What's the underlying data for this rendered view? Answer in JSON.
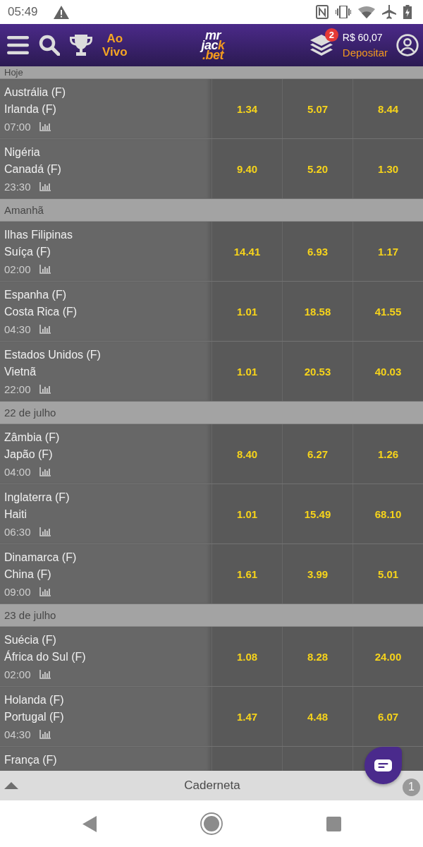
{
  "status_bar": {
    "time": "05:49"
  },
  "header": {
    "live_label": "Ao Vivo",
    "logo": {
      "lines": [
        [
          {
            "text": "mr",
            "accent": false
          }
        ],
        [
          {
            "text": "jac",
            "accent": false
          },
          {
            "text": "k",
            "accent": true
          }
        ],
        [
          {
            "text": ".bet",
            "accent": true
          }
        ]
      ]
    },
    "bets_badge": "2",
    "balance": "R$ 60,07",
    "deposit_label": "Depositar"
  },
  "sections": [
    {
      "label": "Hoje",
      "matches": [
        {
          "teams": [
            "Austrália (F)",
            "Irlanda (F)"
          ],
          "time": "07:00",
          "odds": [
            "1.34",
            "5.07",
            "8.44"
          ]
        },
        {
          "teams": [
            "Nigéria",
            "Canadá (F)"
          ],
          "time": "23:30",
          "odds": [
            "9.40",
            "5.20",
            "1.30"
          ]
        }
      ]
    },
    {
      "label": "Amanhã",
      "matches": [
        {
          "teams": [
            "Ilhas Filipinas",
            "Suíça (F)"
          ],
          "time": "02:00",
          "odds": [
            "14.41",
            "6.93",
            "1.17"
          ]
        },
        {
          "teams": [
            "Espanha (F)",
            "Costa Rica (F)"
          ],
          "time": "04:30",
          "odds": [
            "1.01",
            "18.58",
            "41.55"
          ]
        },
        {
          "teams": [
            "Estados Unidos (F)",
            "Vietnã"
          ],
          "time": "22:00",
          "odds": [
            "1.01",
            "20.53",
            "40.03"
          ]
        }
      ]
    },
    {
      "label": "22 de julho",
      "matches": [
        {
          "teams": [
            "Zâmbia (F)",
            "Japão (F)"
          ],
          "time": "04:00",
          "odds": [
            "8.40",
            "6.27",
            "1.26"
          ]
        },
        {
          "teams": [
            "Inglaterra (F)",
            "Haiti"
          ],
          "time": "06:30",
          "odds": [
            "1.01",
            "15.49",
            "68.10"
          ]
        },
        {
          "teams": [
            "Dinamarca (F)",
            "China (F)"
          ],
          "time": "09:00",
          "odds": [
            "1.61",
            "3.99",
            "5.01"
          ]
        }
      ]
    },
    {
      "label": "23 de julho",
      "matches": [
        {
          "teams": [
            "Suécia (F)",
            "África do Sul (F)"
          ],
          "time": "02:00",
          "odds": [
            "1.08",
            "8.28",
            "24.00"
          ]
        },
        {
          "teams": [
            "Holanda (F)",
            "Portugal (F)"
          ],
          "time": "04:30",
          "odds": [
            "1.47",
            "4.48",
            "6.07"
          ]
        },
        {
          "teams": [
            "França (F)"
          ]
        }
      ]
    }
  ],
  "bet_slip": {
    "label": "Caderneta",
    "count": "1"
  }
}
